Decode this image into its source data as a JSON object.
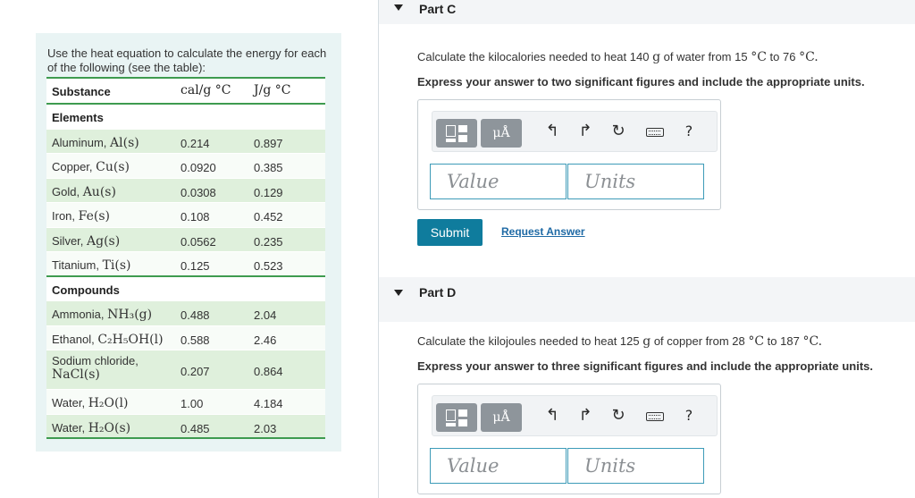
{
  "left": {
    "intro": "Use the heat equation to calculate the energy for each of the following (see the table):",
    "table": {
      "headers": {
        "substance": "Substance",
        "cal": "cal/g °C",
        "joule": "J/g °C"
      },
      "elements_label": "Elements",
      "elements": [
        {
          "name": "Aluminum, ",
          "formula": "Al(s)",
          "cal": "0.214",
          "j": "0.897"
        },
        {
          "name": "Copper, ",
          "formula": "Cu(s)",
          "cal": "0.0920",
          "j": "0.385"
        },
        {
          "name": "Gold, ",
          "formula": "Au(s)",
          "cal": "0.0308",
          "j": "0.129"
        },
        {
          "name": "Iron, ",
          "formula": "Fe(s)",
          "cal": "0.108",
          "j": "0.452"
        },
        {
          "name": "Silver, ",
          "formula": "Ag(s)",
          "cal": "0.0562",
          "j": "0.235"
        },
        {
          "name": "Titanium, ",
          "formula": "Ti(s)",
          "cal": "0.125",
          "j": "0.523"
        }
      ],
      "compounds_label": "Compounds",
      "compounds": [
        {
          "name": "Ammonia, ",
          "formula": "NH₃(g)",
          "cal": "0.488",
          "j": "2.04"
        },
        {
          "name": "Ethanol, ",
          "formula": "C₂H₅OH(l)",
          "cal": "0.588",
          "j": "2.46"
        },
        {
          "name": "Sodium chloride,",
          "formula": "NaCl(s)",
          "cal": "0.207",
          "j": "0.864"
        },
        {
          "name": "Water, ",
          "formula": "H₂O(l)",
          "cal": "1.00",
          "j": "4.184"
        },
        {
          "name": "Water, ",
          "formula": "H₂O(s)",
          "cal": "0.485",
          "j": "2.03"
        }
      ]
    }
  },
  "partC": {
    "title": "Part C",
    "question_prefix": "Calculate the kilocalories needed to heat 140 ",
    "question_unit": "g",
    "question_mid": " of water from 15 ",
    "question_deg1": "°C",
    "question_to": " to 76 ",
    "question_deg2": "°C.",
    "instruction": "Express your answer to two significant figures and include the appropriate units.",
    "value_placeholder": "Value",
    "units_placeholder": "Units",
    "submit_label": "Submit",
    "request_label": "Request Answer"
  },
  "partD": {
    "title": "Part D",
    "question_prefix": "Calculate the kilojoules needed to heat 125 ",
    "question_unit": "g",
    "question_mid": " of copper from 28 ",
    "question_deg1": "°C",
    "question_to": " to 187 ",
    "question_deg2": "°C.",
    "instruction": "Express your answer to three significant figures and include the appropriate units.",
    "value_placeholder": "Value",
    "units_placeholder": "Units"
  },
  "toolbar": {
    "mu_label": "μÅ",
    "undo_glyph": "↰",
    "redo_glyph": "↱",
    "reset_glyph": "↻",
    "help_label": "?"
  },
  "icons": [
    "collapse-triangle-icon",
    "template-icon",
    "undo-icon",
    "redo-icon",
    "reset-icon",
    "keyboard-icon",
    "help-icon"
  ],
  "colors": {
    "accent": "#0f7c9d",
    "table_rule": "#3e9b4f",
    "link": "#1f6aa5",
    "panel_bg": "#e9f4f4"
  }
}
